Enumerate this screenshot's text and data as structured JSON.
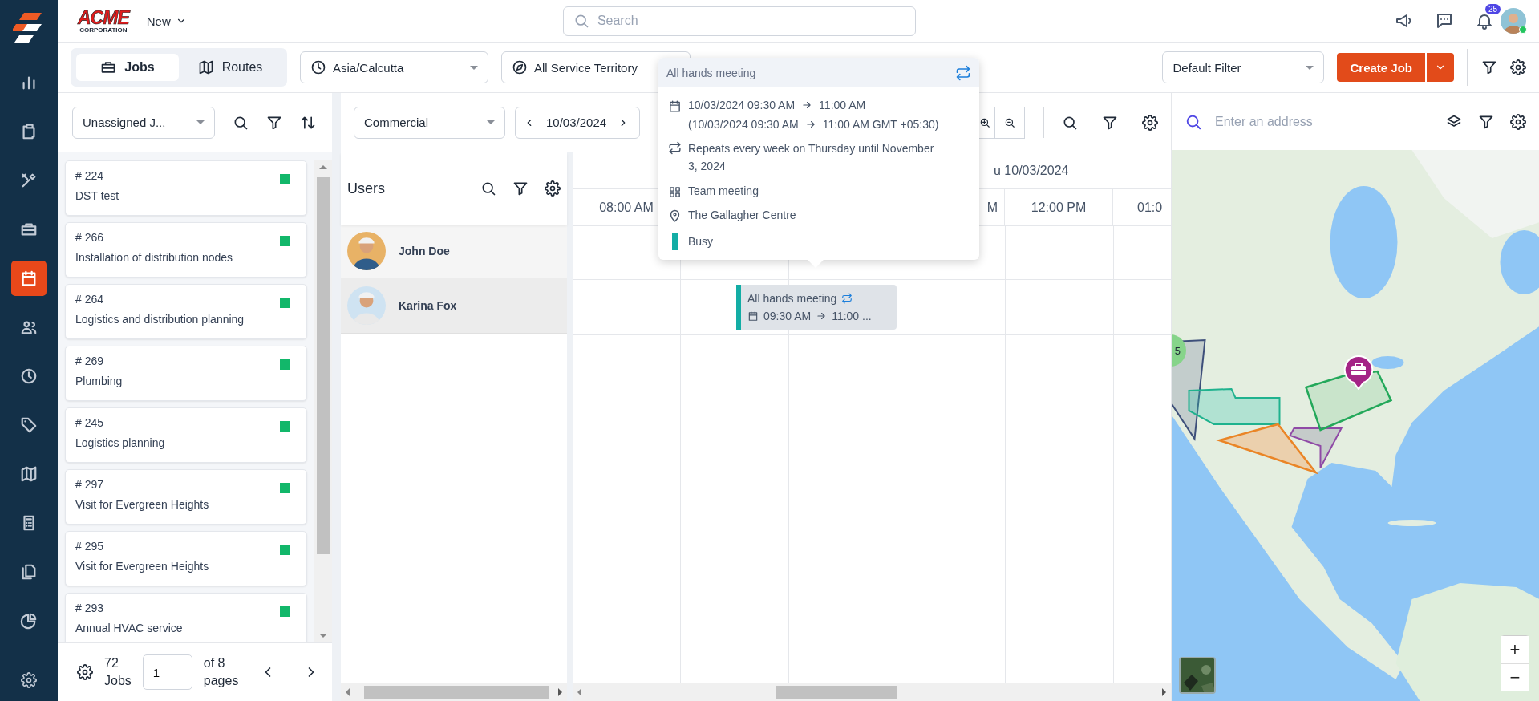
{
  "header": {
    "logo": "ACME",
    "logo_subtitle": "CORPORATION",
    "new_menu": "New",
    "search_placeholder": "Search",
    "notification_count": "25",
    "online": true
  },
  "nav_items": [
    {
      "selected": false
    },
    {
      "selected": false
    },
    {
      "selected": false
    },
    {
      "selected": false
    },
    {
      "selected": true
    },
    {
      "selected": false
    },
    {
      "selected": false
    },
    {
      "selected": false
    },
    {
      "selected": false
    },
    {
      "selected": false
    },
    {
      "selected": false
    },
    {
      "selected": false
    }
  ],
  "view_tabs": [
    {
      "label": "Jobs",
      "selected": true
    },
    {
      "label": "Routes",
      "selected": false
    }
  ],
  "timezone": "Asia/Calcutta",
  "territory": "All Service Territory",
  "saved_filter": "Default Filter",
  "create_button": "Create Job",
  "jobs_panel": {
    "filter": "Unassigned J...",
    "cards": [
      {
        "number": "# 224",
        "title": "DST test",
        "color": "#12b76a"
      },
      {
        "number": "# 266",
        "title": "Installation of distribution nodes",
        "color": "#12b76a"
      },
      {
        "number": "# 264",
        "title": "Logistics and distribution planning",
        "color": "#12b76a"
      },
      {
        "number": "# 269",
        "title": "Plumbing",
        "color": "#12b76a"
      },
      {
        "number": "# 245",
        "title": "Logistics planning",
        "color": "#12b76a"
      },
      {
        "number": "# 297",
        "title": "Visit for Evergreen Heights",
        "color": "#12b76a"
      },
      {
        "number": "# 295",
        "title": "Visit for Evergreen Heights",
        "color": "#12b76a"
      },
      {
        "number": "# 293",
        "title": "Annual HVAC service",
        "color": "#12b76a"
      }
    ],
    "count": "72 Jobs",
    "page": "1",
    "pages": "of 8 pages"
  },
  "schedule": {
    "category": "Commercial",
    "date": "10/03/2024",
    "users_title": "Users",
    "date_header": "u 10/03/2024",
    "time_headers": [
      "08:00 AM",
      "M",
      "12:00 PM",
      "01:0"
    ],
    "users": [
      {
        "name": "John Doe",
        "selected": false
      },
      {
        "name": "Karina Fox",
        "selected": true
      }
    ],
    "event": {
      "title": "All hands meeting",
      "start": "09:30 AM",
      "end": "11:00 ...",
      "color": "#13ada5"
    }
  },
  "tooltip": {
    "title": "All hands meeting",
    "start": "10/03/2024 09:30 AM",
    "end": "11:00 AM",
    "local_start": "(10/03/2024 09:30 AM",
    "local_end": "11:00 AM GMT +05:30)",
    "repeat": "Repeats every week on Thursday until November 3, 2024",
    "type": "Team meeting",
    "location": "The Gallagher Centre",
    "status": {
      "label": "Busy",
      "color": "#13ada5"
    }
  },
  "map": {
    "placeholder": "Enter an address",
    "cluster": "5",
    "zoom_in": "+",
    "zoom_out": "−"
  }
}
